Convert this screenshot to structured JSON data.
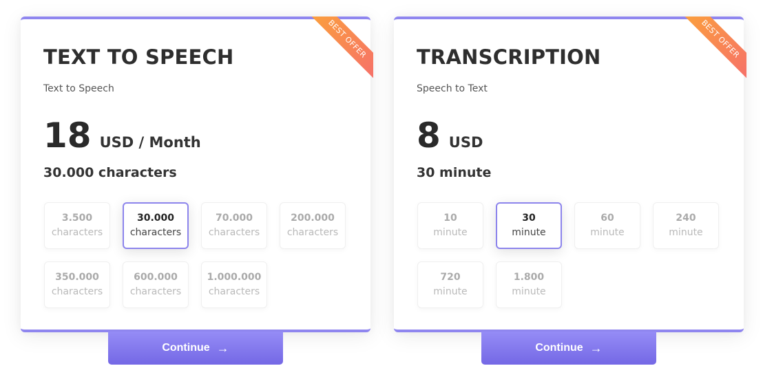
{
  "colors": {
    "accent": "#8f86ef",
    "ribbon_start": "#fba23a",
    "ribbon_end": "#f6706a",
    "button_top": "#958cf6",
    "button_bottom": "#7468e5"
  },
  "cards": [
    {
      "title": "TEXT TO SPEECH",
      "subtitle": "Text to Speech",
      "price": "18",
      "price_unit": "USD / Month",
      "selected_summary": "30.000 characters",
      "ribbon": "Best Offer",
      "options": [
        {
          "amount": "3.500",
          "unit": "characters",
          "selected": false
        },
        {
          "amount": "30.000",
          "unit": "characters",
          "selected": true
        },
        {
          "amount": "70.000",
          "unit": "characters",
          "selected": false
        },
        {
          "amount": "200.000",
          "unit": "characters",
          "selected": false
        },
        {
          "amount": "350.000",
          "unit": "characters",
          "selected": false
        },
        {
          "amount": "600.000",
          "unit": "characters",
          "selected": false
        },
        {
          "amount": "1.000.000",
          "unit": "characters",
          "selected": false
        }
      ],
      "continue_label": "Continue",
      "continue_icon": "arrow-right-icon"
    },
    {
      "title": "TRANSCRIPTION",
      "subtitle": "Speech to Text",
      "price": "8",
      "price_unit": "USD",
      "selected_summary": "30 minute",
      "ribbon": "Best Offer",
      "options": [
        {
          "amount": "10",
          "unit": "minute",
          "selected": false
        },
        {
          "amount": "30",
          "unit": "minute",
          "selected": true
        },
        {
          "amount": "60",
          "unit": "minute",
          "selected": false
        },
        {
          "amount": "240",
          "unit": "minute",
          "selected": false
        },
        {
          "amount": "720",
          "unit": "minute",
          "selected": false
        },
        {
          "amount": "1.800",
          "unit": "minute",
          "selected": false
        }
      ],
      "continue_label": "Continue",
      "continue_icon": "arrow-right-icon"
    }
  ]
}
